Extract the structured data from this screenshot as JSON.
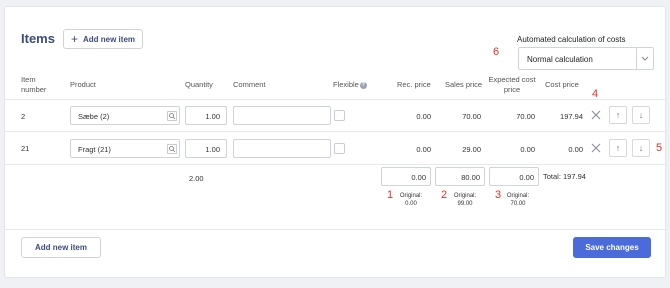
{
  "header": {
    "title": "Items",
    "add_new_item_top": "Add new item",
    "auto_calc_label": "Automated calculation of costs",
    "auto_calc_selected": "Normal calculation"
  },
  "columns": {
    "item_number": "Item number",
    "product": "Product",
    "quantity": "Quantity",
    "comment": "Comment",
    "flexible": "Flexible",
    "rec_price": "Rec. price",
    "sales_price": "Sales price",
    "expected_cost_price": "Expected cost price",
    "cost_price": "Cost price"
  },
  "rows": [
    {
      "item_number": "2",
      "product": "Sæbe (2)",
      "quantity": "1.00",
      "comment": "",
      "flexible": false,
      "rec_price": "0.00",
      "sales_price": "70.00",
      "expected_cost_price": "70.00",
      "cost_price": "197.94"
    },
    {
      "item_number": "21",
      "product": "Fragt (21)",
      "quantity": "1.00",
      "comment": "",
      "flexible": false,
      "rec_price": "0.00",
      "sales_price": "29.00",
      "expected_cost_price": "0.00",
      "cost_price": "0.00"
    }
  ],
  "totals": {
    "quantity": "2.00",
    "rec_price": "0.00",
    "sales_price": "80.00",
    "expected_cost_price": "0.00",
    "total_label": "Total: 197.94",
    "rec_original": "Original: 0.00",
    "sales_original": "Original: 99.00",
    "expected_original": "Original: 70.00"
  },
  "annotations": {
    "a1": "1",
    "a2": "2",
    "a3": "3",
    "a4": "4",
    "a5": "5",
    "a6": "6"
  },
  "footer": {
    "add_new_item": "Add new item",
    "save_changes": "Save changes"
  },
  "icons": {
    "remove": "close-icon",
    "move_up": "arrow-up-icon",
    "move_down": "arrow-down-icon",
    "product_lookup": "lookup-icon",
    "dropdown": "chevron-down-icon",
    "info": "info-icon"
  },
  "colors": {
    "primary": "#4a6bd9",
    "title": "#3b4c7c",
    "annotation": "#e0302b"
  }
}
